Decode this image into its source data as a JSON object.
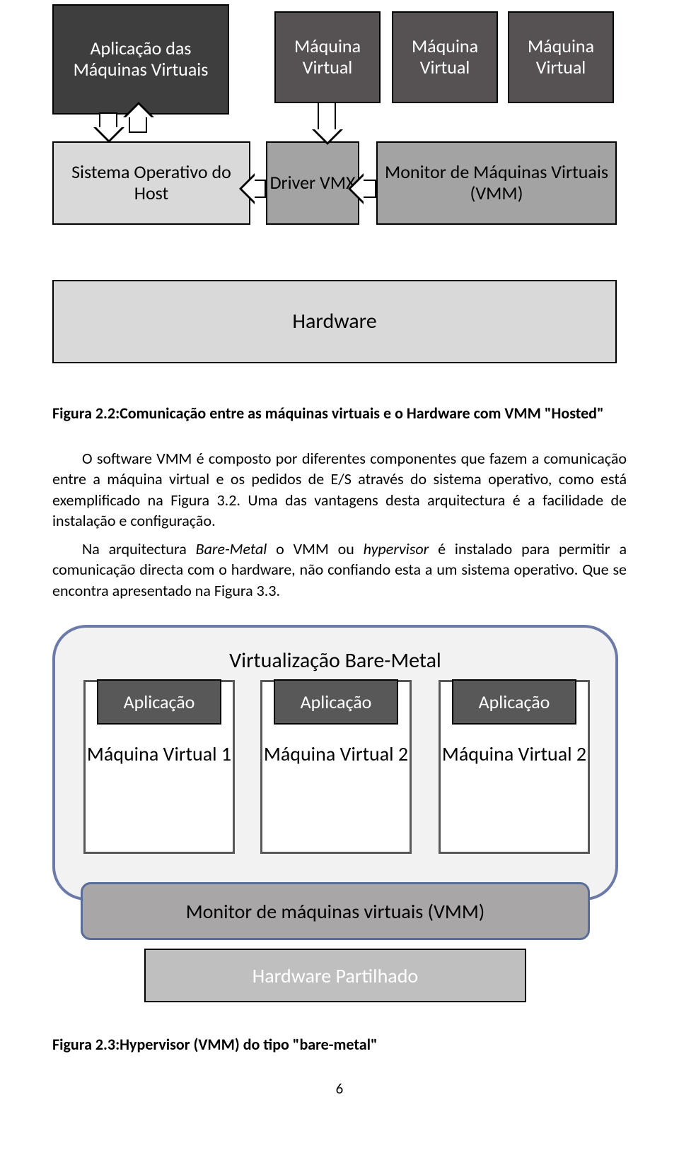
{
  "fig22": {
    "app_vm": "Aplicação das Máquinas Virtuais",
    "vm_label": "Máquina Virtual",
    "host_os": "Sistema Operativo do Host",
    "driver_vmx": "Driver VMX",
    "vmm": "Monitor de Máquinas Virtuais (VMM)",
    "hardware": "Hardware",
    "caption": "Figura 2.2:Comunicação entre as máquinas virtuais e o Hardware com VMM \"Hosted\""
  },
  "paragraphs": {
    "p1_a": "O software VMM é composto por diferentes componentes que fazem a comunicação entre a máquina virtual e os pedidos de E/S através do sistema operativo, como está exemplificado na Figura 3.2. Uma das vantagens desta arquitectura é a facilidade de instalação e configuração.",
    "p2_a": "Na arquitectura ",
    "p2_b": "Bare-Metal",
    "p2_c": " o VMM ou ",
    "p2_d": "hypervisor",
    "p2_e": " é instalado para permitir a comunicação directa com o hardware, não confiando esta a um sistema operativo. Que se encontra apresentado na Figura 3.3."
  },
  "fig23": {
    "title": "Virtualização Bare-Metal",
    "app_label": "Aplicação",
    "vm1": "Máquina Virtual 1",
    "vm2": "Máquina Virtual 2",
    "vm3": "Máquina Virtual 2",
    "vmm_bar": "Monitor de máquinas virtuais (VMM)",
    "hw_part": "Hardware Partilhado",
    "caption": "Figura 2.3:Hypervisor (VMM) do tipo \"bare-metal\""
  },
  "page_number": "6"
}
